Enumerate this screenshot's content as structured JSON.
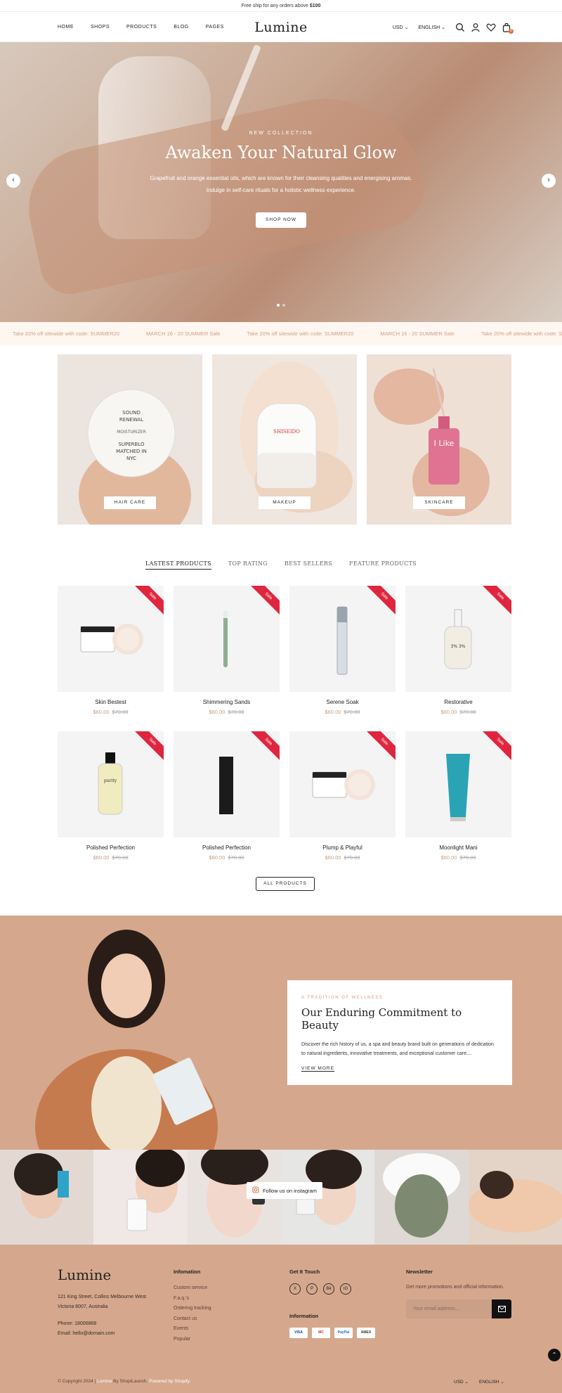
{
  "announcement": {
    "text": "Free ship for any orders above",
    "amount": "$100"
  },
  "header": {
    "nav": [
      "HOME",
      "SHOPS",
      "PRODUCTS",
      "BLOG",
      "PAGES"
    ],
    "logo": "Lumine",
    "currency": "USD",
    "language": "ENGLISH",
    "cart_count": "0"
  },
  "hero": {
    "eyebrow": "NEW COLLECTION",
    "title": "Awaken Your Natural Glow",
    "desc_line1": "Grapefruit and orange essential oils, which are known for their cleansing qualities and energising aromas.",
    "desc_line2": "Indulge in self-care rituals for a holistic wellness experience.",
    "button": "SHOP NOW",
    "prev": "‹",
    "next": "›"
  },
  "marquee": [
    "Take 20% off sitewide with code: SUMMER20",
    "MARCH 16 - 20 SUMMER Sale",
    "Take 20% off sitewide with code: SUMMER20",
    "MARCH 16 - 20 SUMMER Sale",
    "Take 20% off sitewide with code: SUMMER20"
  ],
  "categories": [
    "HAIR CARE",
    "MAKEUP",
    "SKINCARE"
  ],
  "tabs": [
    "LASTEST PRODUCTS",
    "TOP RATING",
    "BEST SELLERS",
    "FEATURE PRODUCTS"
  ],
  "products": [
    {
      "name": "Skin Bestest",
      "price": "$60.00",
      "old": "$70.00",
      "badge": "Sale"
    },
    {
      "name": "Shimmering Sands",
      "price": "$60.00",
      "old": "$70.00",
      "badge": "Sale"
    },
    {
      "name": "Serene Soak",
      "price": "$60.00",
      "old": "$70.00",
      "badge": "Sale"
    },
    {
      "name": "Restorative",
      "price": "$60.00",
      "old": "$70.00",
      "badge": "Sale"
    },
    {
      "name": "Polished Perfection",
      "price": "$60.00",
      "old": "$70.00",
      "badge": "Sale"
    },
    {
      "name": "Polished Perfection",
      "price": "$60.00",
      "old": "$70.00",
      "badge": "Sale"
    },
    {
      "name": "Plump & Playful",
      "price": "$60.00",
      "old": "$70.00",
      "badge": "Sale"
    },
    {
      "name": "Moonlight Mani",
      "price": "$60.00",
      "old": "$70.00",
      "badge": "Sale"
    }
  ],
  "all_products": "ALL PRODUCTS",
  "story": {
    "eyebrow": "A TRADITION OF WELLNESS",
    "title": "Our Enduring Commitment to Beauty",
    "text": "Discover the rich history of us, a spa and beauty brand built on generations of dedication to natural ingredients, innovative treatments, and exceptional customer care....",
    "link": "VIEW MORE"
  },
  "instagram": {
    "button": "Follow us on instagram"
  },
  "footer": {
    "logo": "Lumine",
    "address_line1": "121 King Street, Collins Melbourne West",
    "address_line2": "Victoria 8007, Australia",
    "phone": "Phone: 18006868",
    "email": "Email: hello@domain.com",
    "info_head": "Infomation",
    "info_links": [
      "Custom service",
      "F.a.q.'s",
      "Ordering tracking",
      "Contact us",
      "Events",
      "Popular"
    ],
    "touch_head": "Get It Touch",
    "socials": [
      "X",
      "P",
      "Bē",
      "IG"
    ],
    "info2_head": "Information",
    "payments": [
      "VISA",
      "MC",
      "PayPal",
      "AMEX"
    ],
    "newsletter_head": "Newsletter",
    "newsletter_text": "Get more promotions and official information.",
    "newsletter_placeholder": "Your email address...",
    "copyright_a": "© Copyright 2024 |",
    "copyright_brand": "Lumine",
    "copyright_b": "By ShopiLaunch.",
    "copyright_c": "Powered by Shopify.",
    "currency": "USD",
    "language": "ENGLISH"
  }
}
